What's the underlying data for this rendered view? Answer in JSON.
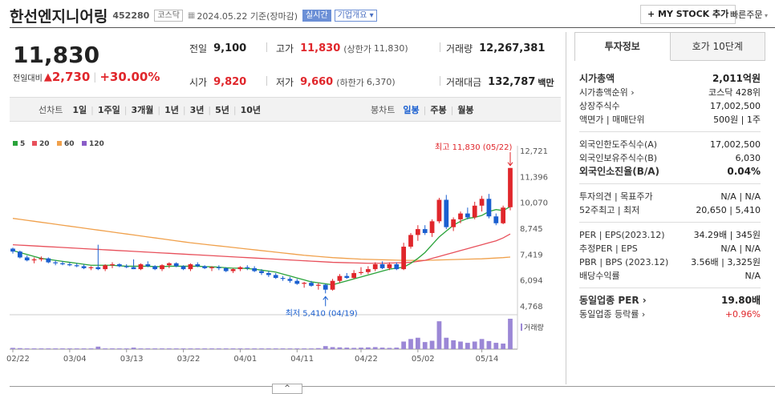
{
  "header": {
    "name": "한선엔지니어링",
    "code": "452280",
    "market": "코스닥",
    "date": "2024.05.22 기준(장마감)",
    "realtime": "실시간",
    "overview": "기업개요",
    "my_stock": "+ MY STOCK 추가",
    "quick_order": "빠른주문"
  },
  "price": {
    "current": "11,830",
    "change_label": "전일대비",
    "change": "2,730",
    "rate": "+30.00%"
  },
  "stats": {
    "prev_label": "전일",
    "prev": "9,100",
    "high_label": "고가",
    "high": "11,830",
    "upper_label": "(상한가",
    "upper": "11,830)",
    "vol_label": "거래량",
    "vol": "12,267,381",
    "open_label": "시가",
    "open": "9,820",
    "low_label": "저가",
    "low": "9,660",
    "lower_label": "(하한가",
    "lower": "6,370)",
    "amt_label": "거래대금",
    "amt": "132,787",
    "amt_unit": "백만"
  },
  "chart_tabs": {
    "line_label": "선차트",
    "periods": [
      "1일",
      "1주일",
      "3개월",
      "1년",
      "3년",
      "5년",
      "10년"
    ],
    "candle_label": "봉차트",
    "candles": [
      "일봉",
      "주봉",
      "월봉"
    ],
    "active_candle": "일봉"
  },
  "colors": {
    "ma5": "#2aa33a",
    "ma20": "#e8505b",
    "ma60": "#f0a04b",
    "ma120": "#8a5cc7",
    "up": "#e0262b",
    "down": "#1a5fd0",
    "accent": "#e0262b"
  },
  "chart_data": {
    "type": "candlestick",
    "legend": [
      {
        "name": "5",
        "color": "#2aa33a"
      },
      {
        "name": "20",
        "color": "#e8505b"
      },
      {
        "name": "60",
        "color": "#f0a04b"
      },
      {
        "name": "120",
        "color": "#8a5cc7"
      }
    ],
    "y_ticks": [
      "12,721",
      "11,396",
      "10,070",
      "8,745",
      "7,419",
      "6,094",
      "4,768"
    ],
    "ylim": [
      4768,
      12721
    ],
    "x_ticks": [
      "02/22",
      "03/04",
      "03/13",
      "03/22",
      "04/01",
      "04/11",
      "04/22",
      "05/02",
      "05/14"
    ],
    "high_annotation": "최고 11,830 (05/22)",
    "low_annotation": "최저 5,410 (04/19)",
    "volume_label": "거래량",
    "candles": [
      [
        7700,
        7750,
        7450,
        7550
      ],
      [
        7550,
        7600,
        7200,
        7250
      ],
      [
        7250,
        7350,
        7050,
        7100
      ],
      [
        7100,
        7250,
        6950,
        7150
      ],
      [
        7150,
        7300,
        7050,
        7200
      ],
      [
        7200,
        7250,
        6950,
        7000
      ],
      [
        7000,
        7100,
        6850,
        6950
      ],
      [
        6950,
        7050,
        6850,
        6900
      ],
      [
        6900,
        7000,
        6800,
        6850
      ],
      [
        6850,
        6950,
        6750,
        6800
      ],
      [
        6800,
        6900,
        6650,
        6700
      ],
      [
        6700,
        6800,
        6600,
        6750
      ],
      [
        6750,
        7900,
        6600,
        6650
      ],
      [
        6650,
        6900,
        6550,
        6850
      ],
      [
        6850,
        7000,
        6700,
        6900
      ],
      [
        6900,
        6950,
        6750,
        6800
      ],
      [
        6800,
        6900,
        6700,
        6750
      ],
      [
        6750,
        7150,
        6650,
        6650
      ],
      [
        6650,
        6950,
        6600,
        6900
      ],
      [
        6900,
        7050,
        6750,
        6800
      ],
      [
        6800,
        6850,
        6600,
        6650
      ],
      [
        6650,
        6900,
        6550,
        6850
      ],
      [
        6850,
        7000,
        6700,
        6950
      ],
      [
        6950,
        7000,
        6750,
        6800
      ],
      [
        6800,
        6850,
        6600,
        6650
      ],
      [
        6650,
        6950,
        6550,
        6900
      ],
      [
        6900,
        7000,
        6750,
        6800
      ],
      [
        6800,
        6850,
        6650,
        6700
      ],
      [
        6700,
        6800,
        6550,
        6750
      ],
      [
        6750,
        6850,
        6600,
        6700
      ],
      [
        6700,
        6750,
        6500,
        6550
      ],
      [
        6550,
        6700,
        6450,
        6650
      ],
      [
        6650,
        6800,
        6550,
        6750
      ],
      [
        6750,
        6850,
        6600,
        6700
      ],
      [
        6700,
        6800,
        6500,
        6550
      ],
      [
        6550,
        6650,
        6350,
        6450
      ],
      [
        6450,
        6550,
        6250,
        6350
      ],
      [
        6350,
        6450,
        6150,
        6200
      ],
      [
        6200,
        6300,
        6050,
        6150
      ],
      [
        6150,
        6250,
        5950,
        6050
      ],
      [
        6050,
        6150,
        5850,
        5900
      ],
      [
        5900,
        6000,
        5700,
        5950
      ],
      [
        5950,
        6050,
        5750,
        5800
      ],
      [
        5800,
        5950,
        5600,
        5850
      ],
      [
        5850,
        5900,
        5410,
        5600
      ],
      [
        5600,
        6150,
        5550,
        6050
      ],
      [
        6050,
        6400,
        5950,
        6300
      ],
      [
        6300,
        6450,
        6150,
        6200
      ],
      [
        6200,
        6600,
        6150,
        6450
      ],
      [
        6450,
        6750,
        6350,
        6500
      ],
      [
        6500,
        6800,
        6400,
        6650
      ],
      [
        6650,
        7000,
        6550,
        6900
      ],
      [
        6900,
        7050,
        6650,
        6700
      ],
      [
        6700,
        7000,
        6600,
        6900
      ],
      [
        6900,
        7000,
        6600,
        6650
      ],
      [
        6650,
        8000,
        6600,
        7800
      ],
      [
        7800,
        8500,
        7700,
        8400
      ],
      [
        8400,
        8900,
        8100,
        8700
      ],
      [
        8700,
        8900,
        8400,
        8500
      ],
      [
        8500,
        9200,
        8300,
        9100
      ],
      [
        9100,
        10300,
        9000,
        10200
      ],
      [
        10200,
        10450,
        8700,
        8800
      ],
      [
        8800,
        9300,
        8600,
        9200
      ],
      [
        9200,
        9600,
        9000,
        9500
      ],
      [
        9500,
        9800,
        9200,
        9300
      ],
      [
        9300,
        10100,
        9200,
        9900
      ],
      [
        9900,
        10400,
        9600,
        10250
      ],
      [
        10250,
        10500,
        9250,
        9350
      ],
      [
        9350,
        9500,
        8900,
        9000
      ],
      [
        9000,
        9900,
        8950,
        9800
      ],
      [
        9820,
        11830,
        9660,
        11830
      ]
    ],
    "volumes": [
      5,
      4,
      3,
      3,
      3,
      3,
      3,
      3,
      3,
      3,
      3,
      3,
      10,
      3,
      3,
      3,
      3,
      6,
      3,
      3,
      3,
      3,
      3,
      3,
      3,
      3,
      3,
      3,
      3,
      3,
      3,
      3,
      3,
      3,
      3,
      3,
      3,
      3,
      3,
      3,
      3,
      3,
      3,
      4,
      12,
      8,
      7,
      6,
      5,
      6,
      7,
      8,
      6,
      5,
      6,
      30,
      40,
      45,
      28,
      33,
      110,
      45,
      35,
      30,
      25,
      30,
      40,
      32,
      25,
      22,
      120
    ],
    "ma5": [
      7600,
      7500,
      7400,
      7300,
      7200,
      7150,
      7100,
      7050,
      7000,
      6950,
      6900,
      6850,
      6850,
      6850,
      6850,
      6820,
      6800,
      6800,
      6800,
      6800,
      6780,
      6780,
      6800,
      6800,
      6800,
      6800,
      6800,
      6780,
      6770,
      6750,
      6720,
      6700,
      6700,
      6680,
      6650,
      6600,
      6550,
      6500,
      6400,
      6300,
      6200,
      6100,
      6000,
      5950,
      5900,
      5850,
      5950,
      6050,
      6150,
      6250,
      6350,
      6450,
      6550,
      6650,
      6700,
      6750,
      6950,
      7200,
      7500,
      7900,
      8300,
      8600,
      8900,
      9100,
      9250,
      9300,
      9400,
      9600,
      9700,
      9650,
      9850
    ],
    "ma20": [
      7900,
      7880,
      7860,
      7840,
      7820,
      7800,
      7780,
      7760,
      7740,
      7720,
      7700,
      7680,
      7660,
      7640,
      7620,
      7600,
      7580,
      7560,
      7540,
      7520,
      7500,
      7480,
      7460,
      7440,
      7420,
      7400,
      7380,
      7360,
      7340,
      7320,
      7300,
      7280,
      7260,
      7240,
      7220,
      7200,
      7180,
      7160,
      7140,
      7120,
      7100,
      7080,
      7060,
      7040,
      7020,
      7000,
      6990,
      6980,
      6970,
      6960,
      6950,
      6950,
      6950,
      6960,
      6970,
      6980,
      7000,
      7050,
      7100,
      7200,
      7300,
      7400,
      7500,
      7600,
      7700,
      7800,
      7900,
      8000,
      8100,
      8250,
      8450
    ],
    "ma60": [
      9250,
      9200,
      9150,
      9100,
      9050,
      9000,
      8950,
      8900,
      8850,
      8800,
      8750,
      8700,
      8650,
      8600,
      8550,
      8500,
      8450,
      8400,
      8350,
      8300,
      8250,
      8200,
      8150,
      8100,
      8050,
      8000,
      7960,
      7920,
      7880,
      7840,
      7800,
      7760,
      7720,
      7680,
      7640,
      7600,
      7560,
      7520,
      7480,
      7440,
      7400,
      7360,
      7330,
      7300,
      7270,
      7240,
      7220,
      7200,
      7180,
      7160,
      7150,
      7140,
      7130,
      7120,
      7110,
      7100,
      7100,
      7100,
      7100,
      7110,
      7120,
      7130,
      7140,
      7150,
      7160,
      7170,
      7180,
      7200,
      7220,
      7240,
      7270
    ]
  },
  "panel": {
    "tabs": [
      "투자정보",
      "호가 10단계"
    ],
    "rows1": [
      {
        "k": "시가총액",
        "v": "2,011억원",
        "bold": true
      },
      {
        "k": "시가총액순위 ›",
        "v": "코스닥 428위"
      },
      {
        "k": "상장주식수",
        "v": "17,002,500"
      },
      {
        "k": "액면가 | 매매단위",
        "v": "500원 | 1주"
      }
    ],
    "rows2": [
      {
        "k": "외국인한도주식수(A)",
        "v": "17,002,500"
      },
      {
        "k": "외국인보유주식수(B)",
        "v": "6,030"
      },
      {
        "k": "외국인소진율(B/A)",
        "v": "0.04%",
        "bold": true
      }
    ],
    "rows3": [
      {
        "k": "투자의견 | 목표주가",
        "v": "N/A | N/A"
      },
      {
        "k": "52주최고 | 최저",
        "v": "20,650 | 5,410"
      }
    ],
    "rows4": [
      {
        "k": "PER | EPS(2023.12)",
        "v": "34.29배 | 345원"
      },
      {
        "k": "추정PER | EPS",
        "v": "N/A | N/A"
      },
      {
        "k": "PBR | BPS (2023.12)",
        "v": "3.56배 | 3,325원"
      },
      {
        "k": "배당수익률",
        "v": "N/A"
      }
    ],
    "rows5": [
      {
        "k": "동일업종 PER ›",
        "v": "19.80배",
        "bold": true
      },
      {
        "k": "동일업종 등락률 ›",
        "v": "+0.96%",
        "red": true
      }
    ]
  },
  "collapse_icon": "^"
}
